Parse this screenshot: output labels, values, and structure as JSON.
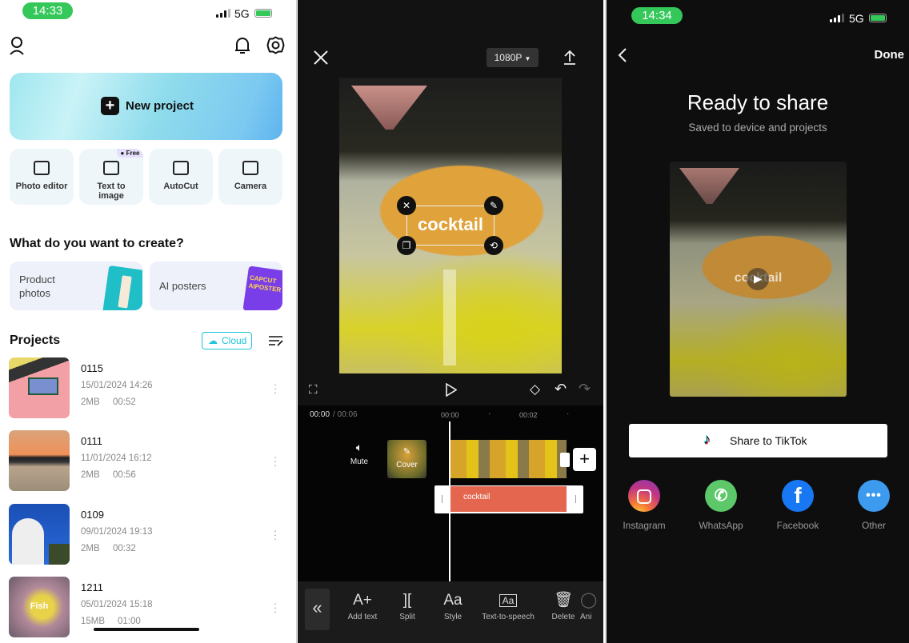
{
  "home": {
    "status": {
      "time": "14:33",
      "network": "5G"
    },
    "new_project": "New project",
    "tools": [
      {
        "label": "Photo editor",
        "icon": "photo-edit-icon"
      },
      {
        "label": "Text to image",
        "icon": "text-image-icon",
        "badge": "Free"
      },
      {
        "label": "AutoCut",
        "icon": "autocut-icon"
      },
      {
        "label": "Camera",
        "icon": "camera-icon"
      }
    ],
    "create_heading": "What do you want to create?",
    "create_cards": [
      {
        "label": "Product photos"
      },
      {
        "label": "AI posters",
        "art_text": "CAPCUT AIPOSTER"
      }
    ],
    "projects_heading": "Projects",
    "cloud_button": "Cloud",
    "projects": [
      {
        "name": "0115",
        "date": "15/01/2024 14:26",
        "size": "2MB",
        "duration": "00:52"
      },
      {
        "name": "0111",
        "date": "11/01/2024 16:12",
        "size": "2MB",
        "duration": "00:56"
      },
      {
        "name": "0109",
        "date": "09/01/2024 19:13",
        "size": "2MB",
        "duration": "00:32"
      },
      {
        "name": "1211",
        "date": "05/01/2024 15:18",
        "size": "15MB",
        "duration": "01:00",
        "thumb_text": "Fish"
      }
    ],
    "accent": "#1ec5d8"
  },
  "editor": {
    "resolution": "1080P",
    "overlay_text": "cocktail",
    "timecode_current": "00:00",
    "timecode_total": "/ 00:06",
    "ruler": [
      "00:00",
      "·",
      "00:02",
      "·"
    ],
    "mute_label": "Mute",
    "cover_label": "Cover",
    "text_clip": "cocktail",
    "text_clip_color": "#e4664f",
    "tools": [
      {
        "label": "Add text",
        "glyph": "A+"
      },
      {
        "label": "Split",
        "glyph": "]["
      },
      {
        "label": "Style",
        "glyph": "Aa"
      },
      {
        "label": "Text-to-speech",
        "glyph": "Aa"
      },
      {
        "label": "Delete",
        "glyph": "🗑"
      },
      {
        "label": "Ani",
        "glyph": "◯"
      }
    ],
    "collapse_glyph": "«"
  },
  "share": {
    "status": {
      "time": "14:34",
      "network": "5G"
    },
    "done": "Done",
    "title": "Ready to share",
    "subtitle": "Saved to device and projects",
    "overlay_text": "cocktail",
    "tiktok_button": "Share to TikTok",
    "targets": [
      {
        "label": "Instagram",
        "color": "#c13584"
      },
      {
        "label": "WhatsApp",
        "color": "#5cc869"
      },
      {
        "label": "Facebook",
        "color": "#1877f2"
      },
      {
        "label": "Other",
        "color": "#3d9bef"
      }
    ]
  }
}
